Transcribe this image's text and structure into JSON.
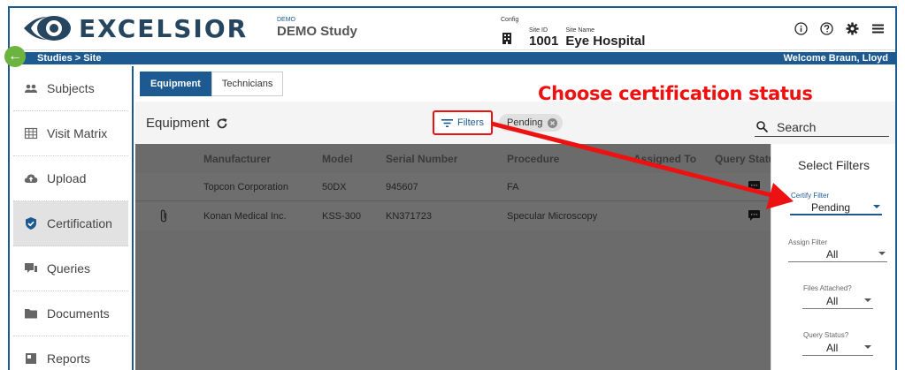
{
  "header": {
    "logo_text": "EXCELSIOR",
    "study_label": "DEMO",
    "study_name": "DEMO Study",
    "config_label": "Config",
    "site_id_label": "Site ID",
    "site_id": "1001",
    "site_name_label": "Site Name",
    "site_name": "Eye Hospital",
    "icons": [
      "info-icon",
      "help-icon",
      "gear-icon",
      "menu-icon"
    ]
  },
  "subbar": {
    "breadcrumb": "Studies > Site",
    "welcome": "Welcome Braun, Lloyd"
  },
  "sidebar": {
    "items": [
      {
        "label": "Subjects",
        "icon": "people-icon"
      },
      {
        "label": "Visit Matrix",
        "icon": "grid-icon"
      },
      {
        "label": "Upload",
        "icon": "cloud-upload-icon"
      },
      {
        "label": "Certification",
        "icon": "shield-check-icon",
        "active": true
      },
      {
        "label": "Queries",
        "icon": "chat-icon"
      },
      {
        "label": "Documents",
        "icon": "folder-icon"
      },
      {
        "label": "Reports",
        "icon": "report-icon"
      }
    ]
  },
  "tabs": [
    {
      "label": "Equipment",
      "active": true
    },
    {
      "label": "Technicians"
    }
  ],
  "toolbar": {
    "title": "Equipment",
    "filters_label": "Filters",
    "chip_label": "Pending",
    "search_placeholder": "Search"
  },
  "callout": "Choose certification status",
  "table": {
    "columns": [
      "Manufacturer",
      "Model",
      "Serial Number",
      "Procedure",
      "Assigned To",
      "Query Status"
    ],
    "rows": [
      {
        "manufacturer": "Topcon Corporation",
        "model": "50DX",
        "serial": "945607",
        "procedure": "FA",
        "attached": false
      },
      {
        "manufacturer": "Konan Medical Inc.",
        "model": "KSS-300",
        "serial": "KN371723",
        "procedure": "Specular Microscopy",
        "attached": true
      }
    ]
  },
  "filters_panel": {
    "title": "Select Filters",
    "certify": {
      "label": "Certify Filter",
      "value": "Pending"
    },
    "assign": {
      "label": "Assign Filter",
      "value": "All"
    },
    "files": {
      "label": "Files Attached?",
      "value": "All"
    },
    "query": {
      "label": "Query Status?",
      "value": "All"
    }
  },
  "colors": {
    "brand": "#1d5a91",
    "accent": "#e11111",
    "back": "#6db33f"
  }
}
